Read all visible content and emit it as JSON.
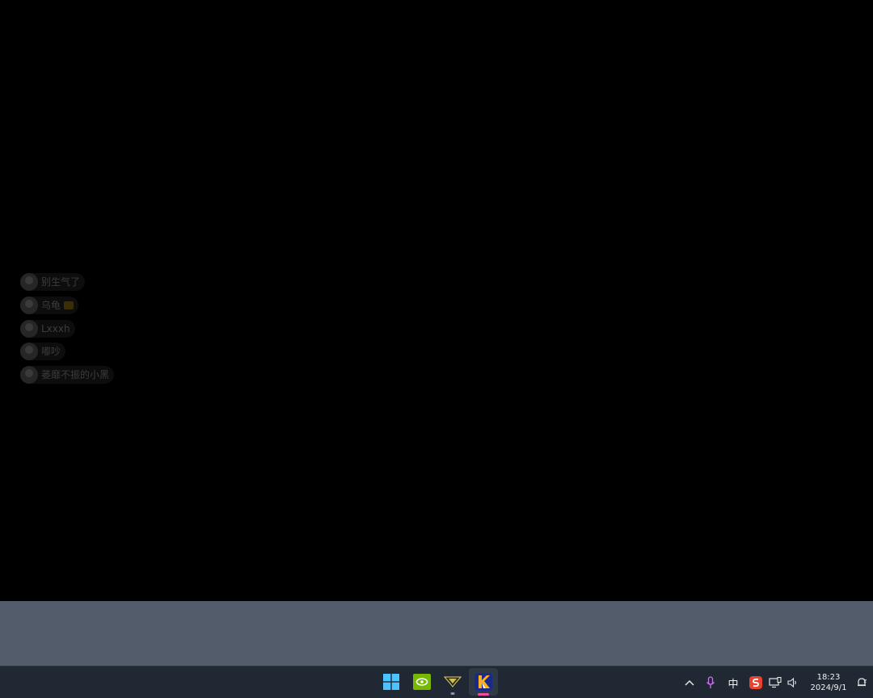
{
  "party": {
    "members": [
      {
        "name": "别生气了",
        "avatar": "avatar-angry"
      },
      {
        "name": "乌龟",
        "avatar": "avatar-turtle",
        "badge": true
      },
      {
        "name": "Lxxxh",
        "avatar": "avatar-cross"
      },
      {
        "name": "嘟吵",
        "avatar": "avatar-dark"
      },
      {
        "name": "萎靡不振的小黑",
        "avatar": "avatar-sunglasses"
      }
    ]
  },
  "taskbar": {
    "apps": [
      {
        "name": "start",
        "icon": "windows-logo-icon"
      },
      {
        "name": "nvidia",
        "icon": "nvidia-icon"
      },
      {
        "name": "game-launcher",
        "icon": "valorant-like-icon",
        "running": true
      },
      {
        "name": "game",
        "icon": "game-k-icon",
        "active": true
      }
    ],
    "tray": {
      "ime_label": "中",
      "time": "18:23",
      "date": "2024/9/1"
    }
  },
  "colors": {
    "taskbar_bg": "#202833",
    "band_bg": "#525c6b",
    "accent": "#f04ea6"
  }
}
